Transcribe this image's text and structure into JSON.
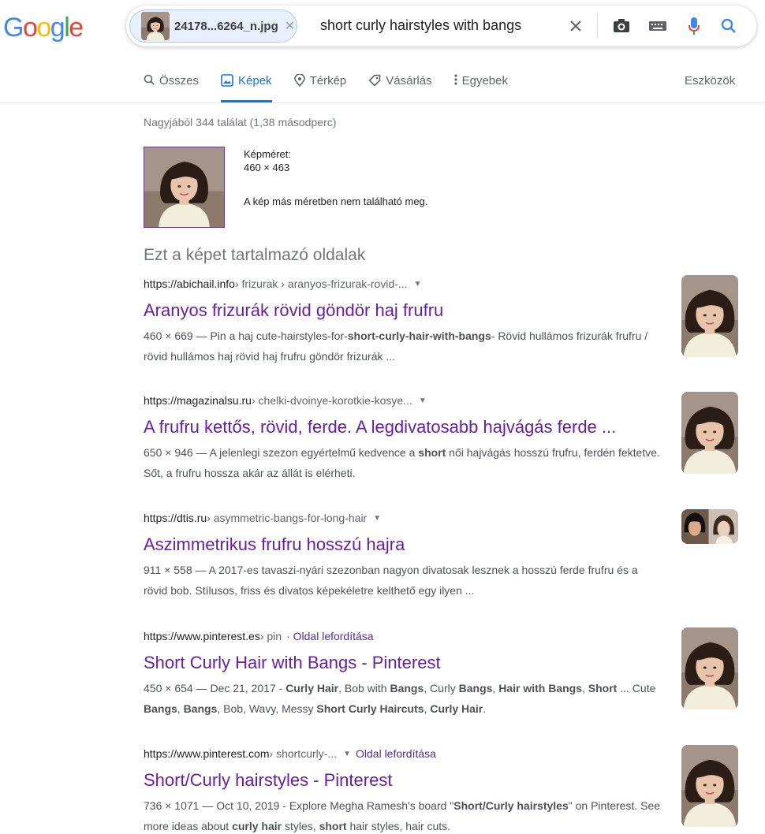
{
  "header": {
    "logo": [
      "G",
      "o",
      "o",
      "g",
      "l",
      "e"
    ],
    "chip_filename": "24178...6264_n.jpg",
    "query": "short curly hairstyles with bangs"
  },
  "tabs": [
    {
      "label": "Összes",
      "icon": "search-icon",
      "active": false
    },
    {
      "label": "Képek",
      "icon": "image-icon",
      "active": true
    },
    {
      "label": "Térkép",
      "icon": "map-pin-icon",
      "active": false
    },
    {
      "label": "Vásárlás",
      "icon": "tag-icon",
      "active": false
    },
    {
      "label": "Egyebek",
      "icon": "more-vert-icon",
      "active": false
    }
  ],
  "tools_label": "Eszközök",
  "stats": "Nagyjából 344 találat (1,38 másodperc)",
  "image_info": {
    "size_label": "Képméret:",
    "size_value": "460 × 463",
    "note": "A kép más méretben nem található meg."
  },
  "section_title": "Ezt a képet tartalmazó oldalak",
  "results": [
    {
      "domain": "https://abichail.info",
      "path": " › frizurak › aranyos-frizurak-rovid-...",
      "translate": "",
      "title": "Aranyos frizurák rövid göndör haj frufru",
      "snippet_html": "460 × 669 — Pin a haj cute-hairstyles-for-<b>short-curly-hair-with-bangs</b>- Rövid hullámos frizurák frufru / rövid hullámos haj rövid haj frufru göndör frizurák ..."
    },
    {
      "domain": "https://magazinalsu.ru",
      "path": " › chelki-dvoinye-korotkie-kosye...",
      "translate": "",
      "title": "A frufru kettős, rövid, ferde. A legdivatosabb hajvágás ferde ...",
      "snippet_html": "650 × 946 — A jelenlegi szezon egyértelmű kedvence a <b>short</b> női hajvágás hosszú frufru, ferdén fektetve. Sőt, a frufru hossza akár az állát is elérheti."
    },
    {
      "domain": "https://dtis.ru",
      "path": " › asymmetric-bangs-for-long-hair",
      "translate": "",
      "title": "Aszimmetrikus frufru hosszú hajra",
      "snippet_html": "911 × 558 — A 2017-es tavaszi-nyári szezonban nagyon divatosak lesznek a hosszú ferde frufru és a rövid bob. Stílusos, friss és divatos képekéletre kelthető egy ilyen ..."
    },
    {
      "domain": "https://www.pinterest.es",
      "path": " › pin",
      "translate": "· Oldal lefordítása",
      "title": "Short Curly Hair with Bangs - Pinterest",
      "snippet_html": "450 × 654 — Dec 21, 2017 - <b>Curly Hair</b>, Bob with <b>Bangs</b>, Curly <b>Bangs</b>, <b>Hair with Bangs</b>, <b>Short</b> ... Cute <b>Bangs</b>, <b>Bangs</b>, Bob, Wavy, Messy <b>Short Curly Haircuts</b>, <b>Curly Hair</b>."
    },
    {
      "domain": "https://www.pinterest.com",
      "path": " › shortcurly-...",
      "translate": "Oldal lefordítása",
      "title": "Short/Curly hairstyles - Pinterest",
      "snippet_html": "736 × 1071 — Oct 10, 2019 - Explore Megha Ramesh's board \"<b>Short/Curly hairstyles</b>\" on Pinterest. See more ideas about <b>curly hair</b> styles, <b>short</b> hair styles, hair cuts."
    }
  ],
  "colors": {
    "accent": "#1a73e8",
    "visited_link": "#681da8",
    "logo": [
      "#4285f4",
      "#ea4335",
      "#fbbc05",
      "#4285f4",
      "#34a853",
      "#ea4335"
    ]
  }
}
